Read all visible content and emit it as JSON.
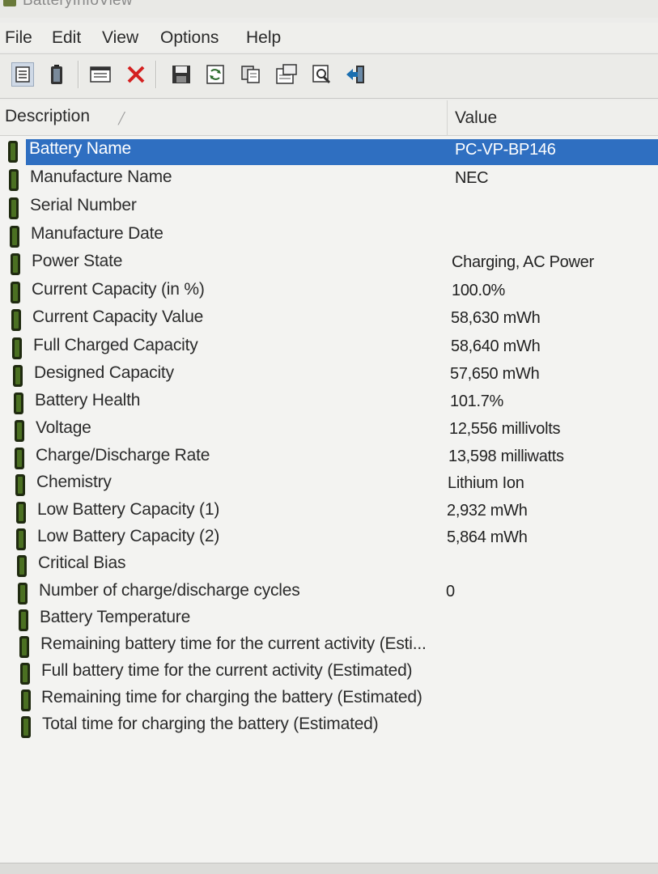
{
  "window": {
    "title": "BatteryInfoView"
  },
  "menu": [
    "File",
    "Edit",
    "View",
    "Options",
    "Help"
  ],
  "toolbar": {
    "buttons": [
      {
        "name": "simple-mode-icon"
      },
      {
        "name": "battery-log-icon"
      },
      {
        "name": "properties-icon"
      },
      {
        "name": "delete-icon"
      },
      {
        "name": "save-icon"
      },
      {
        "name": "refresh-icon"
      },
      {
        "name": "copy-icon"
      },
      {
        "name": "html-report-icon"
      },
      {
        "name": "find-icon"
      },
      {
        "name": "exit-icon"
      }
    ]
  },
  "columns": {
    "description": "Description",
    "value": "Value"
  },
  "rows": [
    {
      "description": "Battery Name",
      "value": "PC-VP-BP146",
      "selected": true
    },
    {
      "description": "Manufacture Name",
      "value": "NEC"
    },
    {
      "description": "Serial Number",
      "value": ""
    },
    {
      "description": "Manufacture Date",
      "value": ""
    },
    {
      "description": "Power State",
      "value": "Charging, AC Power"
    },
    {
      "description": "Current Capacity (in %)",
      "value": "100.0%"
    },
    {
      "description": "Current Capacity Value",
      "value": "58,630 mWh"
    },
    {
      "description": "Full Charged Capacity",
      "value": "58,640 mWh"
    },
    {
      "description": "Designed Capacity",
      "value": "57,650 mWh"
    },
    {
      "description": "Battery Health",
      "value": "101.7%"
    },
    {
      "description": "Voltage",
      "value": "12,556 millivolts"
    },
    {
      "description": "Charge/Discharge Rate",
      "value": "13,598 milliwatts"
    },
    {
      "description": "Chemistry",
      "value": "Lithium Ion"
    },
    {
      "description": "Low Battery Capacity (1)",
      "value": "2,932 mWh"
    },
    {
      "description": "Low Battery Capacity (2)",
      "value": "5,864 mWh"
    },
    {
      "description": "Critical Bias",
      "value": ""
    },
    {
      "description": "Number of charge/discharge cycles",
      "value": "0"
    },
    {
      "description": "Battery Temperature",
      "value": ""
    },
    {
      "description": "Remaining battery time for the current activity (Esti...",
      "value": ""
    },
    {
      "description": "Full battery time for the current activity (Estimated)",
      "value": ""
    },
    {
      "description": "Remaining time for charging the battery (Estimated)",
      "value": ""
    },
    {
      "description": "Total  time for charging the battery (Estimated)",
      "value": ""
    }
  ],
  "colors": {
    "selection": "#2f6fc1",
    "battery_icon": "#4b7022"
  }
}
